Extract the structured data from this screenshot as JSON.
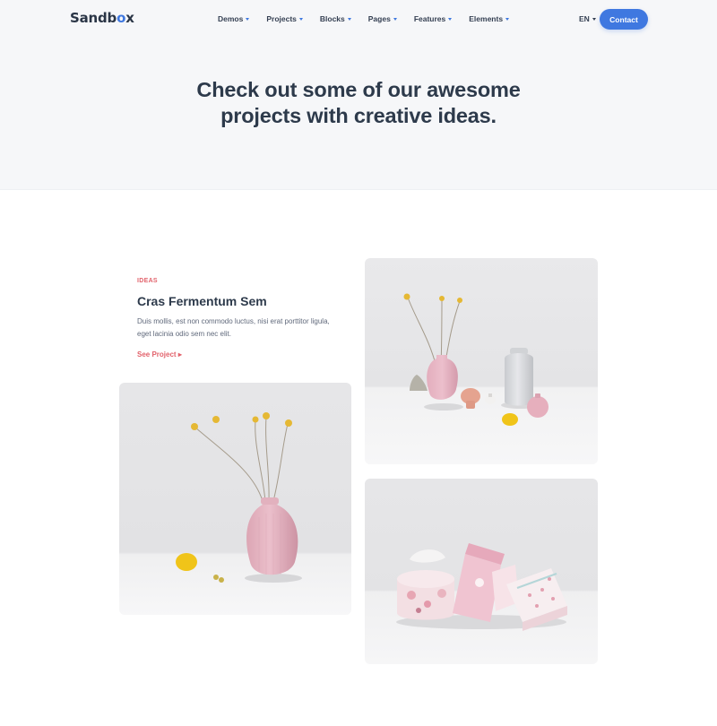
{
  "navbar": {
    "logo": {
      "text_before": "Sandb",
      "text_accent": "o",
      "text_after": "x"
    },
    "menu": [
      {
        "label": "Demos"
      },
      {
        "label": "Projects"
      },
      {
        "label": "Blocks"
      },
      {
        "label": "Pages"
      },
      {
        "label": "Features"
      },
      {
        "label": "Elements"
      }
    ],
    "language": "EN",
    "contact_label": "Contact"
  },
  "hero": {
    "title_line1": "Check out some of our awesome",
    "title_line2": "projects with creative ideas."
  },
  "project": {
    "eyebrow": "IDEAS",
    "title": "Cras Fermentum Sem",
    "description": "Duis mollis, est non commodo luctus, nisi erat porttitor ligula, eget lacinia odio sem nec elit.",
    "link_label": "See Project",
    "link_arrow": "▸"
  },
  "colors": {
    "accent_blue": "#3f78e0",
    "accent_red": "#e2626b",
    "heading": "#2d3a4b",
    "hero_bg": "#f6f7f9"
  },
  "images": [
    {
      "name": "vases-still-life",
      "icon": "photo"
    },
    {
      "name": "pink-vase-with-flowers",
      "icon": "photo"
    },
    {
      "name": "pink-gift-boxes",
      "icon": "photo"
    }
  ]
}
